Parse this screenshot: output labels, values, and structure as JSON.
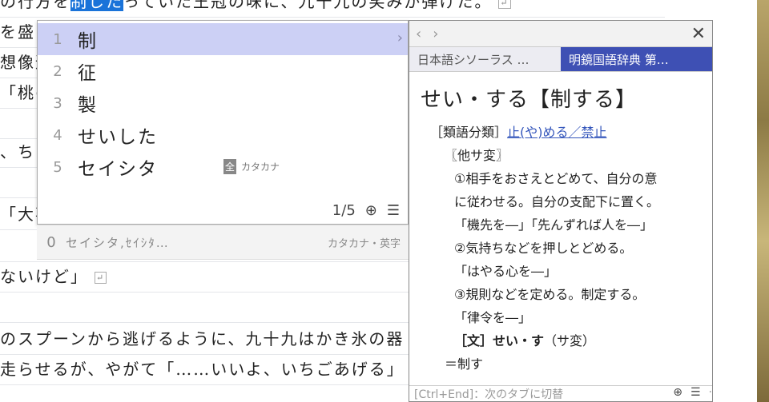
{
  "editor": {
    "lines": [
      {
        "before": "の行方を",
        "selected": "制した",
        "after": "っていた王冠の味に、九十九の笑みが弾けた。",
        "ret": true
      },
      {
        "text": "を盛ら"
      },
      {
        "text": "想像通"
      },
      {
        "text": "「桃の"
      },
      {
        "text": ""
      },
      {
        "text": "、ち"
      },
      {
        "text": ""
      },
      {
        "text": "「大事"
      },
      {
        "text": ""
      },
      {
        "text": "ないけど」",
        "ret": true
      },
      {
        "text": ""
      },
      {
        "text": "のスプーンから逃げるように、九十九はかき氷の器"
      },
      {
        "text": "走らせるが、やがて「……いいよ、いちごあげる」"
      }
    ],
    "return_mark": "↵"
  },
  "candidates": {
    "items": [
      {
        "num": "1",
        "word": "制"
      },
      {
        "num": "2",
        "word": "征"
      },
      {
        "num": "3",
        "word": "製"
      },
      {
        "num": "4",
        "word": "せいした"
      },
      {
        "num": "5",
        "word": "セイシタ",
        "badge": "全",
        "badge_label": "カタカナ"
      }
    ],
    "page": "1/5",
    "zero": {
      "num": "0",
      "word": "セイシタ,ｾｲｼﾀ…",
      "category": "カタカナ・英字"
    }
  },
  "dictionary": {
    "tabs": [
      "日本語シソーラス …",
      "明鏡国語辞典 第…"
    ],
    "headword": "せい・する【制する】",
    "category_label": "［類語分類］",
    "category_link": "止(や)める／禁止",
    "pos": "〖他サ変〗",
    "lines": [
      "①相手をおさえとどめて、自分の意",
      "に従わせる。自分の支配下に置く。",
      "「機先を―」「先んずれば人を―」",
      "②気持ちなどを押しとどめる。",
      "「はやる心を―」",
      "③規則などを定める。制定する。",
      "「律令を―」"
    ],
    "bungo": "［文］せい・す",
    "bungo_note": "（サ変）",
    "eq": "＝制す",
    "footer": "[Ctrl+End]：次のタブに切替"
  }
}
